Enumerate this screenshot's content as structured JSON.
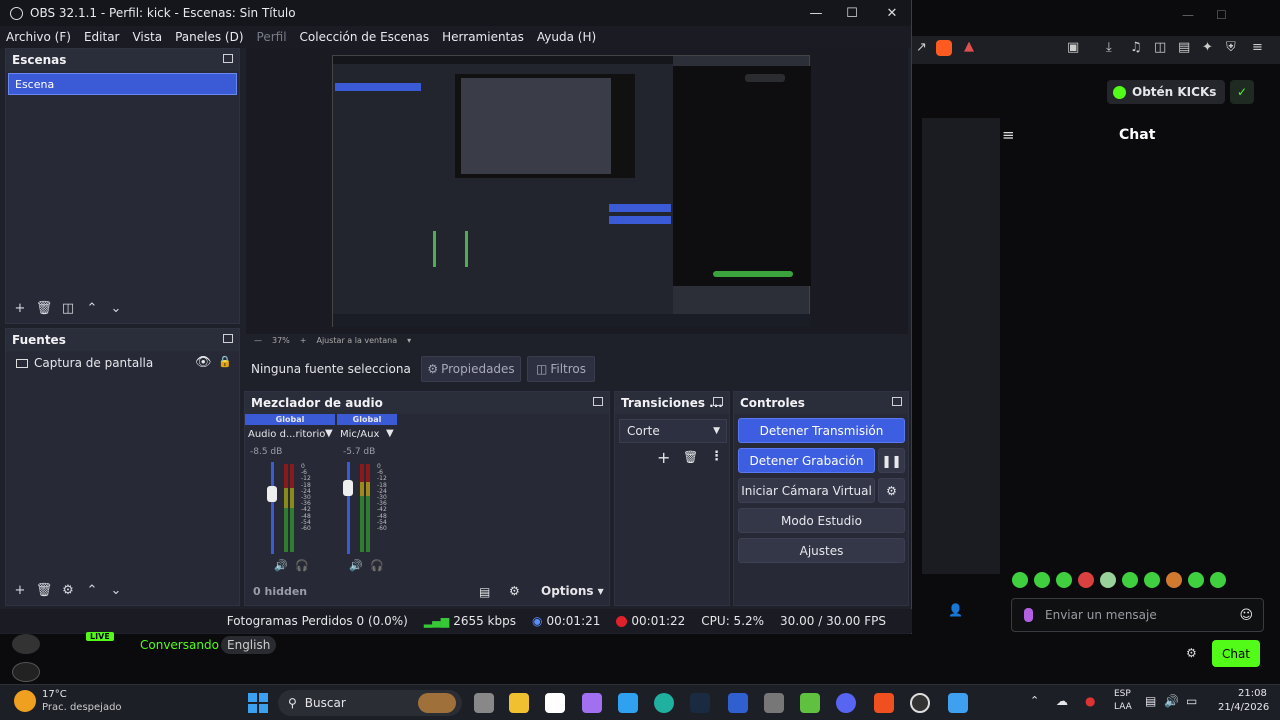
{
  "obs": {
    "title": "OBS 32.1.1 - Perfil: kick - Escenas: Sin Título",
    "menu": [
      "Archivo (F)",
      "Editar",
      "Vista",
      "Paneles (D)",
      "Perfil",
      "Colección de Escenas",
      "Herramientas",
      "Ayuda (H)"
    ],
    "scenes": {
      "title": "Escenas",
      "items": [
        "Escena"
      ]
    },
    "sources": {
      "title": "Fuentes",
      "items": [
        "Captura de pantalla"
      ]
    },
    "preview": {
      "zoom": "37%",
      "fit": "Ajustar a la ventana"
    },
    "no_source": "Ninguna fuente selecciona",
    "properties": "Propiedades",
    "filters": "Filtros",
    "mixer": {
      "title": "Mezclador de audio",
      "channels": [
        {
          "badge": "Global",
          "name": "Audio d...ritorio",
          "db": "-8.5 dB"
        },
        {
          "badge": "Global",
          "name": "Mic/Aux",
          "db": "-5.7 dB"
        }
      ],
      "scale": [
        "0",
        "-6",
        "-12",
        "-18",
        "-24",
        "-30",
        "-36",
        "-42",
        "-48",
        "-54",
        "-60"
      ],
      "hidden": "0 hidden",
      "options": "Options"
    },
    "transitions": {
      "title": "Transiciones ...",
      "selected": "Corte"
    },
    "controls": {
      "title": "Controles",
      "stop_stream": "Detener Transmisión",
      "stop_record": "Detener Grabación",
      "virtual_cam": "Iniciar Cámara Virtual",
      "studio_mode": "Modo Estudio",
      "settings": "Ajustes"
    },
    "status": {
      "dropped": "Fotogramas Perdidos 0 (0.0%)",
      "kbps": "2655 kbps",
      "stream_time": "00:01:21",
      "rec_time": "00:01:22",
      "cpu": "CPU: 5.2%",
      "fps": "30.00 / 30.00 FPS"
    }
  },
  "kick": {
    "get_kicks": "Obtén KICKs",
    "chat_title": "Chat",
    "message_placeholder": "Enviar un mensaje",
    "chat_button": "Chat",
    "live_badge": "LIVE",
    "category": "Conversando",
    "language": "English"
  },
  "taskbar": {
    "weather_temp": "17°C",
    "weather_desc": "Prac. despejado",
    "search": "Buscar",
    "lang1": "ESP",
    "lang2": "LAA",
    "time": "21:08",
    "date": "21/4/2026"
  },
  "colors": {
    "accent": "#3d5ee0",
    "kick_green": "#53fc18",
    "rec_red": "#e0202a"
  }
}
